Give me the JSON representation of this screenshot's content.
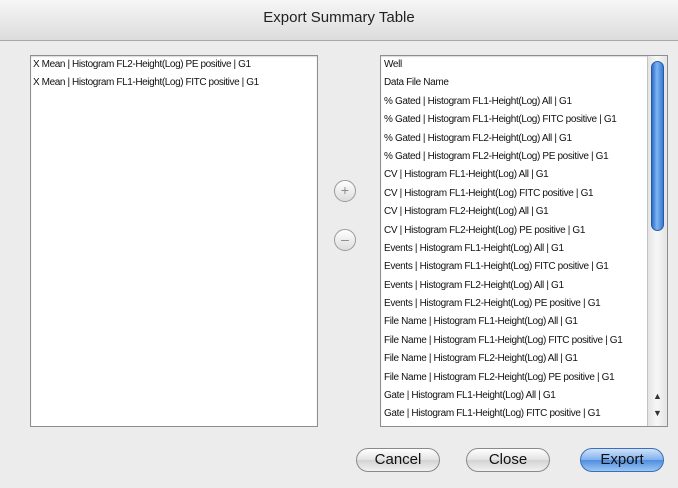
{
  "window": {
    "title": "Export Summary Table"
  },
  "left_list": {
    "items": [
      "X Mean | Histogram FL2-Height(Log) PE positive | G1",
      "X Mean | Histogram FL1-Height(Log) FITC positive | G1"
    ]
  },
  "right_list": {
    "items": [
      "Well",
      "Data File Name",
      "% Gated | Histogram FL1-Height(Log) All | G1",
      "% Gated | Histogram FL1-Height(Log) FITC positive | G1",
      "% Gated | Histogram FL2-Height(Log) All | G1",
      "% Gated | Histogram FL2-Height(Log) PE positive | G1",
      "CV | Histogram FL1-Height(Log) All | G1",
      "CV | Histogram FL1-Height(Log) FITC positive | G1",
      "CV | Histogram FL2-Height(Log) All | G1",
      "CV | Histogram FL2-Height(Log) PE positive | G1",
      "Events | Histogram FL1-Height(Log) All | G1",
      "Events | Histogram FL1-Height(Log) FITC positive | G1",
      "Events | Histogram FL2-Height(Log) All | G1",
      "Events | Histogram FL2-Height(Log) PE positive | G1",
      "File Name | Histogram FL1-Height(Log) All | G1",
      "File Name | Histogram FL1-Height(Log) FITC positive | G1",
      "File Name | Histogram FL2-Height(Log) All | G1",
      "File Name | Histogram FL2-Height(Log) PE positive | G1",
      "Gate | Histogram FL1-Height(Log) All | G1",
      "Gate | Histogram FL1-Height(Log) FITC positive | G1"
    ]
  },
  "controls": {
    "add_symbol": "+",
    "remove_symbol": "–",
    "scroll_up_symbol": "▲",
    "scroll_down_symbol": "▼"
  },
  "buttons": {
    "cancel": "Cancel",
    "close": "Close",
    "export": "Export"
  },
  "colors": {
    "accent": "#4f8de0",
    "window_bg": "#ececec"
  }
}
